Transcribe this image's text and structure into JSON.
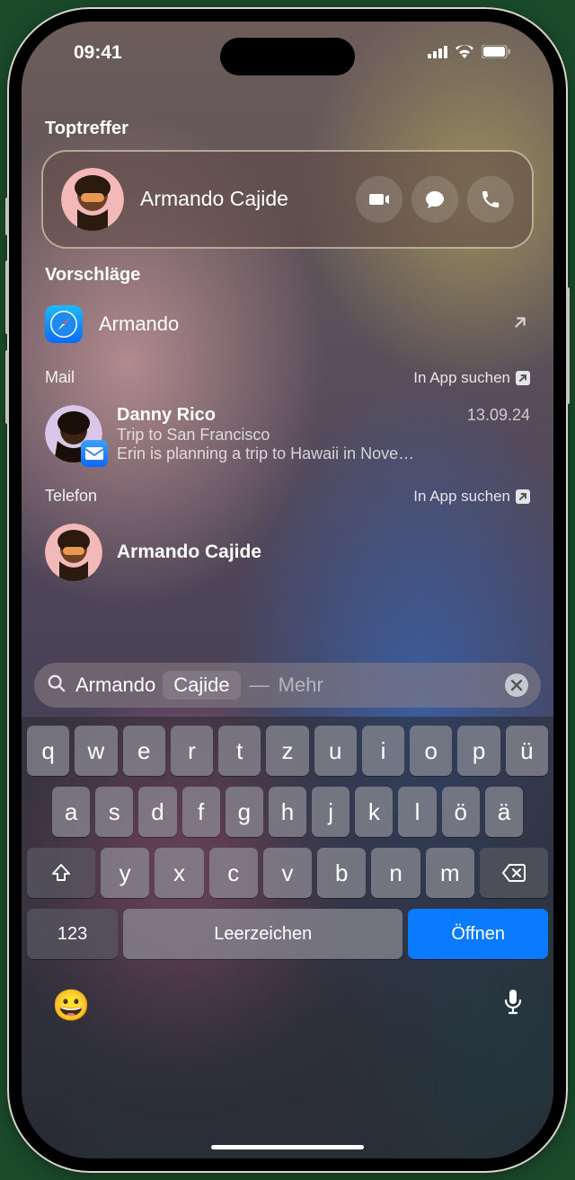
{
  "status": {
    "time": "09:41"
  },
  "sections": {
    "tophit": "Toptreffer",
    "suggestions": "Vorschläge",
    "mail": "Mail",
    "phone": "Telefon",
    "in_app": "In App suchen"
  },
  "tophit": {
    "name": "Armando Cajide"
  },
  "suggestion": {
    "label": "Armando"
  },
  "mail": {
    "sender": "Danny Rico",
    "date": "13.09.24",
    "subject": "Trip to San Francisco",
    "preview": "Erin is planning a trip to Hawaii in Nove…"
  },
  "phone_result": {
    "name": "Armando Cajide"
  },
  "search": {
    "typed": "Armando",
    "completion": "Cajide",
    "separator": "—",
    "more": "Mehr"
  },
  "keyboard": {
    "row1": [
      "q",
      "w",
      "e",
      "r",
      "t",
      "z",
      "u",
      "i",
      "o",
      "p",
      "ü"
    ],
    "row2": [
      "a",
      "s",
      "d",
      "f",
      "g",
      "h",
      "j",
      "k",
      "l",
      "ö",
      "ä"
    ],
    "row3": [
      "y",
      "x",
      "c",
      "v",
      "b",
      "n",
      "m"
    ],
    "num": "123",
    "space": "Leerzeichen",
    "action": "Öffnen"
  }
}
